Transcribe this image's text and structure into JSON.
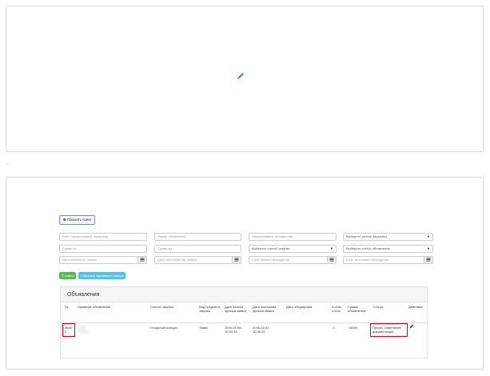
{
  "top_panel": {
    "loading_icon": "pencil-icon"
  },
  "separator_text": ".",
  "search": {
    "toggle_label": "Показать поиск",
    "fields": {
      "bin_placeholder": "БИН, наименование заказчика",
      "number_placeholder": "Номер объявления",
      "name_placeholder": "Наименование объявления",
      "region_value": "Выберите регион заказчика",
      "sum_from_placeholder": "Сумма от",
      "sum_to_placeholder": "Сумма до",
      "method_value": "Выберите способ закупки",
      "status_value": "Выберите статус объявления",
      "date_start_placeholder": "Дата начала пр. заявок",
      "date_end_placeholder": "Дата окончания пр. заявок",
      "discuss_start_placeholder": "Срок начала обсуждения",
      "discuss_end_placeholder": "Срок окончания обсуждения"
    },
    "find_label": "Найти",
    "reset_label": "Сбросить параметры поиска"
  },
  "ads": {
    "heading": "Объявления",
    "columns": [
      "№",
      "Название объявления",
      "Способ закупки",
      "Вид предмета закупки",
      "Дата начала приема заявок",
      "Дата окончания приема заявок",
      "Дата обсуждения",
      "Кол-во лотов",
      "Сумма объявления",
      "Статус",
      "Действия"
    ],
    "rows": [
      {
        "number": "4846 2",
        "title": "",
        "method": "Открытый конкурс",
        "subject": "Товар",
        "start": "2016-01-08 16:30:15",
        "end": "2016-02-01 16:30:29",
        "discussion": "",
        "lots": "1",
        "sum": "15000",
        "status": "Проект. Изменение документации"
      }
    ]
  },
  "colors": {
    "find_button": "#5cb85c",
    "reset_button": "#5bc0de",
    "highlight": "#d0021b"
  }
}
